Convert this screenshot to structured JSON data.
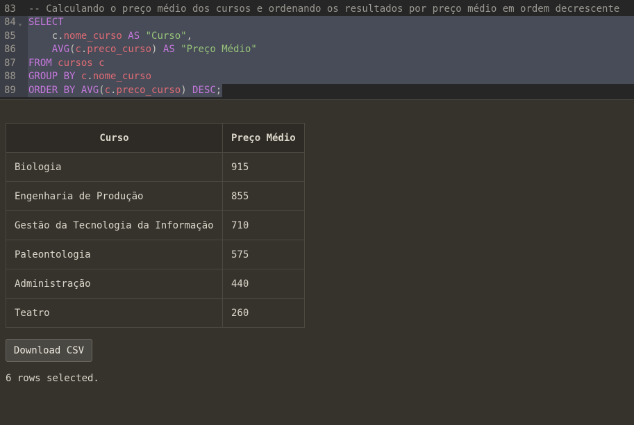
{
  "editor": {
    "lines": [
      {
        "number": "83",
        "segments": [
          {
            "t": "-- Calculando o preço médio dos cursos e ordenando os resultados por preço médio em ordem decrescente",
            "c": "comment"
          }
        ]
      },
      {
        "number": "84",
        "fold": "⌄",
        "segments": [
          {
            "t": "SELECT",
            "c": "kw"
          }
        ]
      },
      {
        "number": "85",
        "segments": [
          {
            "t": "    c.",
            "c": "plain"
          },
          {
            "t": "nome_curso",
            "c": "id"
          },
          {
            "t": " AS ",
            "c": "kw"
          },
          {
            "t": "\"Curso\"",
            "c": "str"
          },
          {
            "t": ",",
            "c": "plain"
          }
        ]
      },
      {
        "number": "86",
        "segments": [
          {
            "t": "    AVG",
            "c": "kw"
          },
          {
            "t": "(",
            "c": "plain"
          },
          {
            "t": "c",
            "c": "id"
          },
          {
            "t": ".",
            "c": "plain"
          },
          {
            "t": "preco_curso",
            "c": "id"
          },
          {
            "t": ") ",
            "c": "plain"
          },
          {
            "t": "AS ",
            "c": "kw"
          },
          {
            "t": "\"Preço Médio\"",
            "c": "str"
          }
        ]
      },
      {
        "number": "87",
        "segments": [
          {
            "t": "FROM ",
            "c": "kw"
          },
          {
            "t": "cursos c",
            "c": "id"
          }
        ]
      },
      {
        "number": "88",
        "segments": [
          {
            "t": "GROUP BY ",
            "c": "kw"
          },
          {
            "t": "c",
            "c": "id"
          },
          {
            "t": ".",
            "c": "plain"
          },
          {
            "t": "nome_curso",
            "c": "id"
          }
        ]
      },
      {
        "number": "89",
        "segments": [
          {
            "t": "ORDER BY AVG",
            "c": "kw"
          },
          {
            "t": "(",
            "c": "plain"
          },
          {
            "t": "c",
            "c": "id"
          },
          {
            "t": ".",
            "c": "plain"
          },
          {
            "t": "preco_curso",
            "c": "id"
          },
          {
            "t": ") ",
            "c": "plain"
          },
          {
            "t": "DESC",
            "c": "kw"
          },
          {
            "t": ";",
            "c": "plain"
          }
        ]
      }
    ]
  },
  "results": {
    "headers": [
      "Curso",
      "Preço Médio"
    ],
    "rows": [
      [
        "Biologia",
        "915"
      ],
      [
        "Engenharia de Produção",
        "855"
      ],
      [
        "Gestão da Tecnologia da Informação",
        "710"
      ],
      [
        "Paleontologia",
        "575"
      ],
      [
        "Administração",
        "440"
      ],
      [
        "Teatro",
        "260"
      ]
    ]
  },
  "download_label": "Download CSV",
  "status_text": "6 rows selected.",
  "colors": {
    "background": "#36332d",
    "editor_background": "#262626",
    "selection": "#474c58",
    "keyword": "#c678dd",
    "identifier": "#e06c75",
    "string": "#98c379",
    "comment": "#9b9993"
  }
}
